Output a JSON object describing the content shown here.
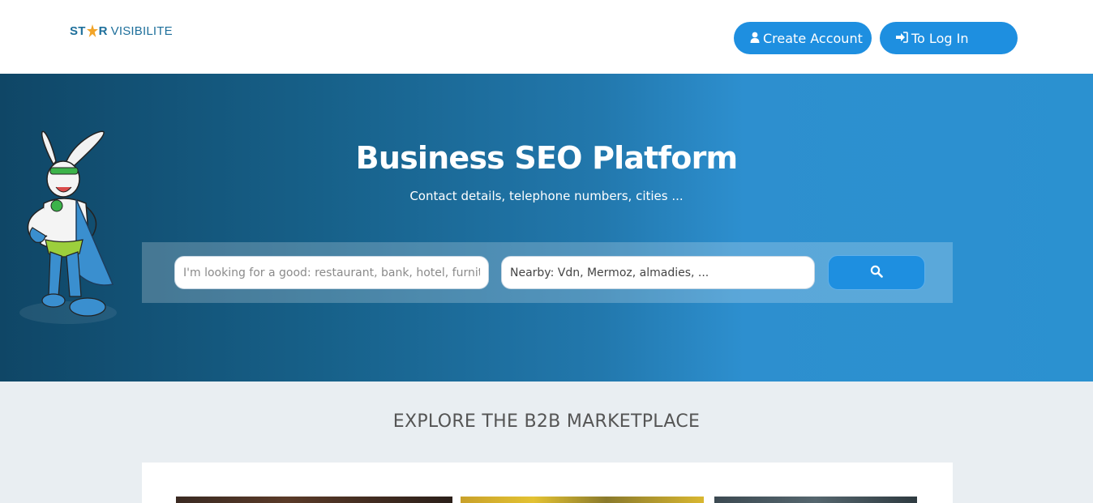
{
  "header": {
    "logo": {
      "part1": "ST",
      "part2": "R",
      "part3": "VISIBILITE"
    },
    "create_account_label": "Create Account",
    "login_label": "To Log In"
  },
  "hero": {
    "title": "Business SEO Platform",
    "subtitle": "Contact details, telephone numbers, cities ...",
    "search": {
      "what_placeholder": "I'm looking for a good: restaurant, bank, hotel, furniture",
      "where_placeholder": "Nearby: Vdn, Mermoz, almadies, ...",
      "button_icon": "search-icon"
    }
  },
  "explore": {
    "title": "EXPLORE THE B2B MARKETPLACE"
  },
  "icons": {
    "create": "user-icon",
    "login": "sign-in-icon",
    "search": "search-icon"
  },
  "colors": {
    "primary": "#1e8fe0",
    "hero_dark": "#0f4666",
    "hero_light": "#2b91d0",
    "background": "#e9eef2"
  }
}
